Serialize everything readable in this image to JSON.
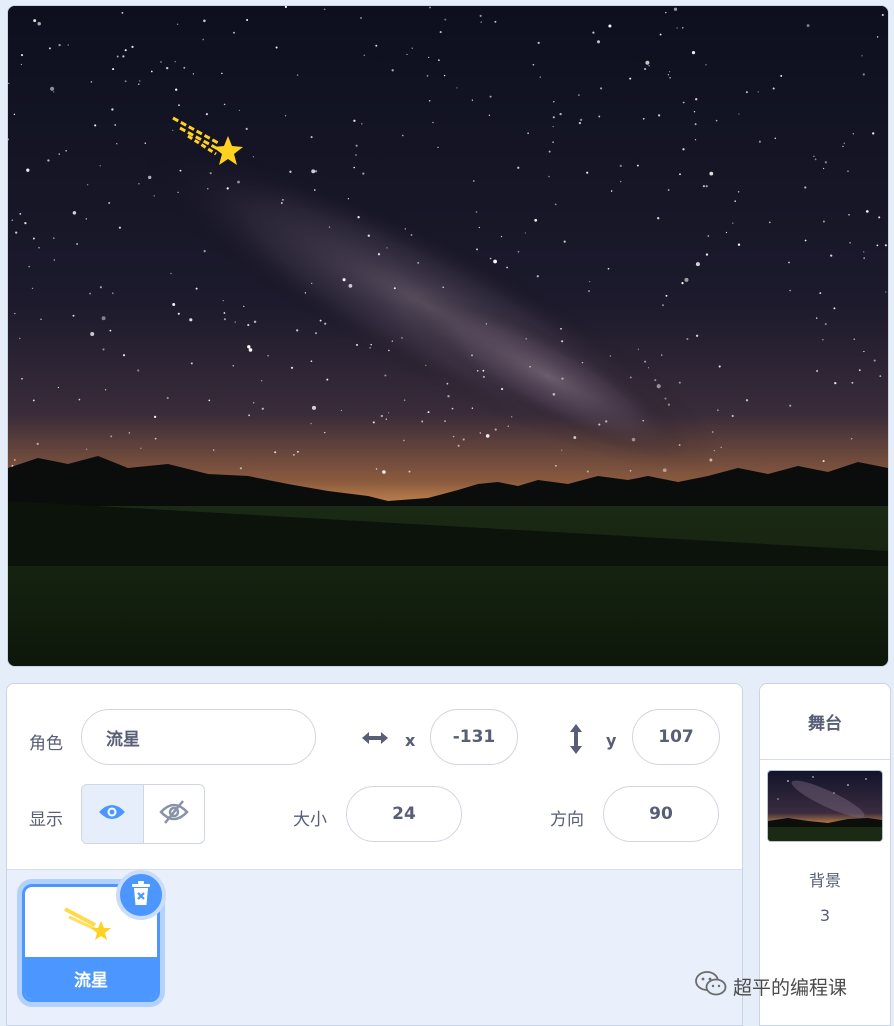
{
  "stage": {
    "sprite_icon": "shooting-star-icon",
    "colors": {
      "sky_top": "#0e1020",
      "horizon_glow": "#c97a3a",
      "grass": "#1c2c14",
      "star": "#ffd21f"
    }
  },
  "sprite_info": {
    "sprite_label": "角色",
    "sprite_name": "流星",
    "x_label": "x",
    "x_value": "-131",
    "y_label": "y",
    "y_value": "107",
    "show_label": "显示",
    "size_label": "大小",
    "size_value": "24",
    "direction_label": "方向",
    "direction_value": "90",
    "icons": [
      "horizontal-arrows-icon",
      "vertical-arrows-icon",
      "eye-icon",
      "eye-slash-icon"
    ]
  },
  "sprite_list": [
    {
      "name": "流星",
      "selected": true,
      "icon": "shooting-star-icon"
    }
  ],
  "stage_pane": {
    "title": "舞台",
    "backdrop_label": "背景",
    "backdrop_count": "3"
  },
  "watermark": {
    "text": "超平的编程课",
    "icon": "wechat-icon"
  },
  "colors": {
    "accent": "#4c97ff",
    "text": "#575e75",
    "panel_bg": "#e9f0fb"
  }
}
